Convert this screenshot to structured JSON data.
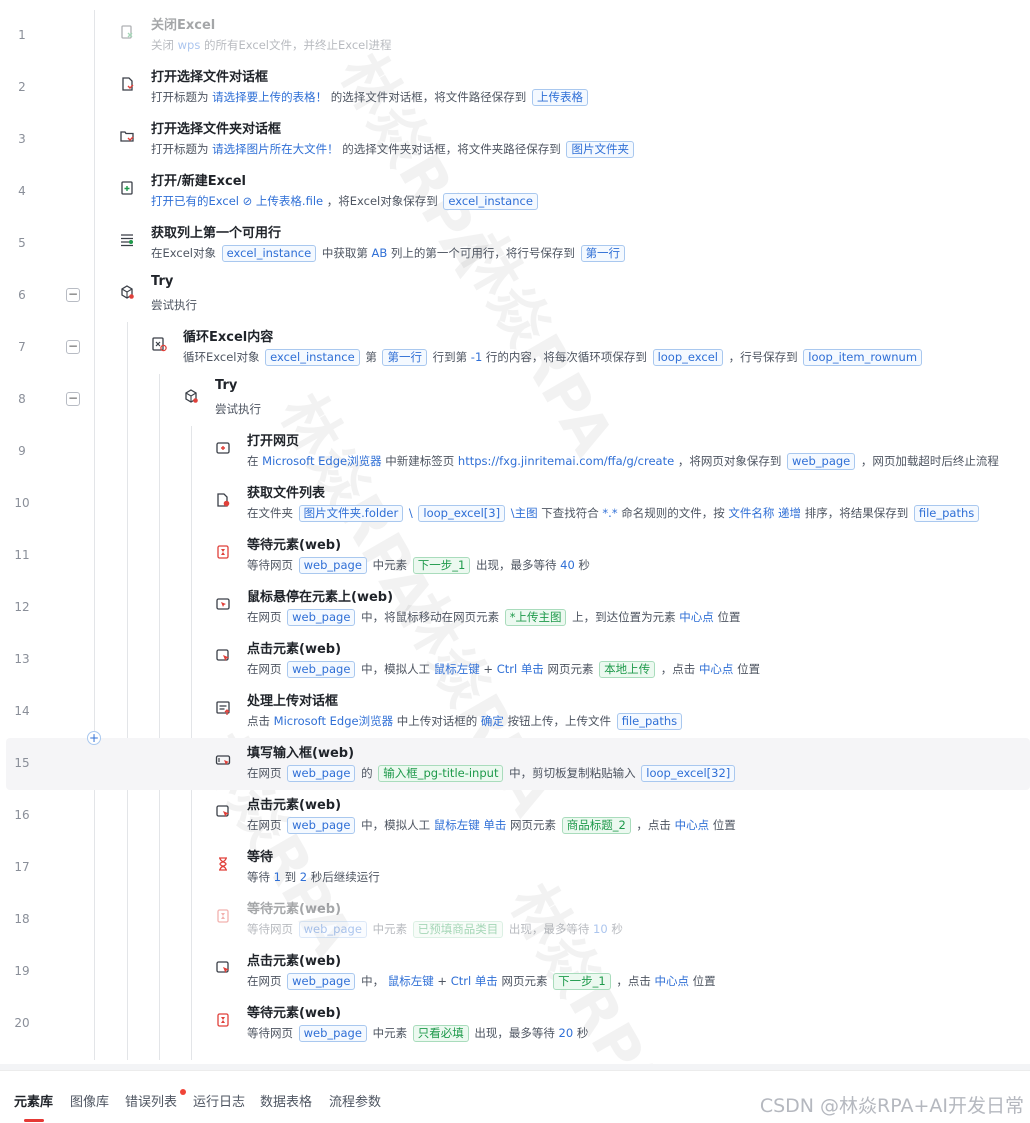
{
  "steps": [
    {
      "num": "1",
      "title": "关闭Excel",
      "disabled": true,
      "icon": "close-excel-icon",
      "desc": [
        {
          "t": "关闭 "
        },
        {
          "t": "wps",
          "k": "b"
        },
        {
          "t": " 的所有Excel文件，并终止Excel进程"
        }
      ]
    },
    {
      "num": "2",
      "title": "打开选择文件对话框",
      "icon": "file-dialog-icon",
      "desc": [
        {
          "t": "打开标题为 "
        },
        {
          "t": "请选择要上传的表格！",
          "k": "b"
        },
        {
          "t": " 的选择文件对话框，将文件路径保存到 "
        },
        {
          "t": "上传表格",
          "k": "v"
        }
      ]
    },
    {
      "num": "3",
      "title": "打开选择文件夹对话框",
      "icon": "folder-dialog-icon",
      "desc": [
        {
          "t": "打开标题为 "
        },
        {
          "t": "请选择图片所在大文件！",
          "k": "b"
        },
        {
          "t": " 的选择文件夹对话框，将文件夹路径保存到 "
        },
        {
          "t": "图片文件夹",
          "k": "v"
        }
      ]
    },
    {
      "num": "4",
      "title": "打开/新建Excel",
      "icon": "excel-open-icon",
      "desc": [
        {
          "t": "打开已有的Excel ",
          "k": "b"
        },
        {
          "t": "⊘ 上传表格.file",
          "k": "b"
        },
        {
          "t": " ，将Excel对象保存到 "
        },
        {
          "t": "excel_instance",
          "k": "v"
        }
      ]
    },
    {
      "num": "5",
      "title": "获取列上第一个可用行",
      "icon": "column-rows-icon",
      "desc": [
        {
          "t": "在Excel对象 "
        },
        {
          "t": "excel_instance",
          "k": "v"
        },
        {
          "t": " 中获取第 "
        },
        {
          "t": "AB",
          "k": "b"
        },
        {
          "t": " 列上的第一个可用行，将行号保存到 "
        },
        {
          "t": "第一行",
          "k": "v"
        }
      ]
    },
    {
      "num": "6",
      "title": "Try",
      "collapse": true,
      "icon": "try-cube-icon",
      "desc": [
        {
          "t": "尝试执行"
        }
      ]
    },
    {
      "num": "7",
      "title": "循环Excel内容",
      "collapse": true,
      "icon": "loop-excel-icon",
      "desc": [
        {
          "t": "循环Excel对象 "
        },
        {
          "t": "excel_instance",
          "k": "v"
        },
        {
          "t": " 第 "
        },
        {
          "t": "第一行",
          "k": "v"
        },
        {
          "t": " 行到第 "
        },
        {
          "t": "-1",
          "k": "b"
        },
        {
          "t": " 行的内容，将每次循环项保存到 "
        },
        {
          "t": "loop_excel",
          "k": "v"
        },
        {
          "t": " ，行号保存到 "
        },
        {
          "t": "loop_item_rownum",
          "k": "v"
        }
      ]
    },
    {
      "num": "8",
      "title": "Try",
      "collapse": true,
      "icon": "try-cube-icon",
      "desc": [
        {
          "t": "尝试执行"
        }
      ]
    },
    {
      "num": "9",
      "title": "打开网页",
      "icon": "open-webpage-icon",
      "desc": [
        {
          "t": "在 "
        },
        {
          "t": "Microsoft Edge浏览器",
          "k": "b"
        },
        {
          "t": " 中新建标签页 "
        },
        {
          "t": "https://fxg.jinritemai.com/ffa/g/create",
          "k": "b"
        },
        {
          "t": " ，将网页对象保存到 "
        },
        {
          "t": "web_page",
          "k": "v"
        },
        {
          "t": " ，网页加载超时后终止流程"
        }
      ]
    },
    {
      "num": "10",
      "title": "获取文件列表",
      "icon": "file-list-icon",
      "desc": [
        {
          "t": "在文件夹 "
        },
        {
          "t": "图片文件夹.folder",
          "k": "v"
        },
        {
          "t": " \\ ",
          "k": "b"
        },
        {
          "t": "loop_excel[3]",
          "k": "v"
        },
        {
          "t": " \\主图",
          "k": "b"
        },
        {
          "t": " 下查找符合 "
        },
        {
          "t": "*.*",
          "k": "b"
        },
        {
          "t": " 命名规则的文件，按 "
        },
        {
          "t": "文件名称",
          "k": "b"
        },
        {
          "t": " "
        },
        {
          "t": "递增",
          "k": "b"
        },
        {
          "t": " 排序，将结果保存到 "
        },
        {
          "t": "file_paths",
          "k": "v"
        }
      ]
    },
    {
      "num": "11",
      "title": "等待元素(web)",
      "icon": "wait-element-icon",
      "desc": [
        {
          "t": "等待网页 "
        },
        {
          "t": "web_page",
          "k": "v"
        },
        {
          "t": " 中元素 "
        },
        {
          "t": "下一步_1",
          "k": "e"
        },
        {
          "t": " 出现，最多等待 "
        },
        {
          "t": "40",
          "k": "b"
        },
        {
          "t": " 秒"
        }
      ]
    },
    {
      "num": "12",
      "title": "鼠标悬停在元素上(web)",
      "icon": "hover-element-icon",
      "desc": [
        {
          "t": "在网页 "
        },
        {
          "t": "web_page",
          "k": "v"
        },
        {
          "t": " 中，将鼠标移动在网页元素 "
        },
        {
          "t": "*上传主图",
          "k": "e"
        },
        {
          "t": " 上，到达位置为元素 "
        },
        {
          "t": "中心点",
          "k": "b"
        },
        {
          "t": " 位置"
        }
      ]
    },
    {
      "num": "13",
      "title": "点击元素(web)",
      "icon": "click-element-icon",
      "desc": [
        {
          "t": "在网页 "
        },
        {
          "t": "web_page",
          "k": "v"
        },
        {
          "t": " 中，模拟人工 "
        },
        {
          "t": "鼠标左键",
          "k": "b"
        },
        {
          "t": " + "
        },
        {
          "t": "Ctrl",
          "k": "b"
        },
        {
          "t": " "
        },
        {
          "t": "单击",
          "k": "b"
        },
        {
          "t": " 网页元素 "
        },
        {
          "t": "本地上传",
          "k": "e"
        },
        {
          "t": " ，点击 "
        },
        {
          "t": "中心点",
          "k": "b"
        },
        {
          "t": " 位置"
        }
      ]
    },
    {
      "num": "14",
      "title": "处理上传对话框",
      "icon": "upload-dialog-icon",
      "desc": [
        {
          "t": "点击 "
        },
        {
          "t": "Microsoft Edge浏览器",
          "k": "b"
        },
        {
          "t": " 中上传对话框的 "
        },
        {
          "t": "确定",
          "k": "b"
        },
        {
          "t": " 按钮上传，上传文件 "
        },
        {
          "t": "file_paths",
          "k": "v"
        }
      ]
    },
    {
      "num": "15",
      "title": "填写输入框(web)",
      "highlight": true,
      "icon": "input-field-icon",
      "desc": [
        {
          "t": "在网页 "
        },
        {
          "t": "web_page",
          "k": "v"
        },
        {
          "t": " 的 "
        },
        {
          "t": "输入框_pg-title-input",
          "k": "e"
        },
        {
          "t": " 中，剪切板复制粘贴输入 "
        },
        {
          "t": "loop_excel[32]",
          "k": "v"
        }
      ]
    },
    {
      "num": "16",
      "title": "点击元素(web)",
      "icon": "click-element-icon",
      "desc": [
        {
          "t": "在网页 "
        },
        {
          "t": "web_page",
          "k": "v"
        },
        {
          "t": " 中，模拟人工 "
        },
        {
          "t": "鼠标左键",
          "k": "b"
        },
        {
          "t": " "
        },
        {
          "t": "单击",
          "k": "b"
        },
        {
          "t": " 网页元素 "
        },
        {
          "t": "商品标题_2",
          "k": "e"
        },
        {
          "t": " ，点击 "
        },
        {
          "t": "中心点",
          "k": "b"
        },
        {
          "t": " 位置"
        }
      ]
    },
    {
      "num": "17",
      "title": "等待",
      "icon": "hourglass-icon",
      "desc": [
        {
          "t": "等待 "
        },
        {
          "t": "1",
          "k": "b"
        },
        {
          "t": " 到 "
        },
        {
          "t": "2",
          "k": "b"
        },
        {
          "t": " 秒后继续运行"
        }
      ]
    },
    {
      "num": "18",
      "title": "等待元素(web)",
      "disabled": true,
      "icon": "wait-element-icon",
      "desc": [
        {
          "t": "等待网页 "
        },
        {
          "t": "web_page",
          "k": "v"
        },
        {
          "t": " 中元素 "
        },
        {
          "t": "已预填商品类目",
          "k": "e"
        },
        {
          "t": " 出现，最多等待 "
        },
        {
          "t": "10",
          "k": "b"
        },
        {
          "t": " 秒"
        }
      ]
    },
    {
      "num": "19",
      "title": "点击元素(web)",
      "icon": "click-element-icon",
      "desc": [
        {
          "t": "在网页 "
        },
        {
          "t": "web_page",
          "k": "v"
        },
        {
          "t": " 中， "
        },
        {
          "t": "鼠标左键",
          "k": "b"
        },
        {
          "t": " + "
        },
        {
          "t": "Ctrl",
          "k": "b"
        },
        {
          "t": " "
        },
        {
          "t": "单击",
          "k": "b"
        },
        {
          "t": " 网页元素 "
        },
        {
          "t": "下一步_1",
          "k": "e"
        },
        {
          "t": " ，点击 "
        },
        {
          "t": "中心点",
          "k": "b"
        },
        {
          "t": " 位置"
        }
      ]
    },
    {
      "num": "20",
      "title": "等待元素(web)",
      "icon": "wait-element-icon",
      "desc": [
        {
          "t": "等待网页 "
        },
        {
          "t": "web_page",
          "k": "v"
        },
        {
          "t": " 中元素 "
        },
        {
          "t": "只看必填",
          "k": "e"
        },
        {
          "t": " 出现，最多等待 "
        },
        {
          "t": "20",
          "k": "b"
        },
        {
          "t": " 秒"
        }
      ]
    }
  ],
  "watermark": "林焱RPA",
  "tabs": [
    {
      "label": "元素库",
      "active": true
    },
    {
      "label": "图像库"
    },
    {
      "label": "错误列表",
      "dot": true
    },
    {
      "label": "运行日志"
    },
    {
      "label": "数据表格"
    },
    {
      "label": "流程参数"
    }
  ],
  "brand": "CSDN @林焱RPA+AI开发日常",
  "colors": {
    "accent": "#2f6fd6",
    "element_green": "#1f9a4b",
    "error_dot": "#f04438",
    "icon_red": "#e0403a",
    "tab_active_underline": "#e53935"
  }
}
